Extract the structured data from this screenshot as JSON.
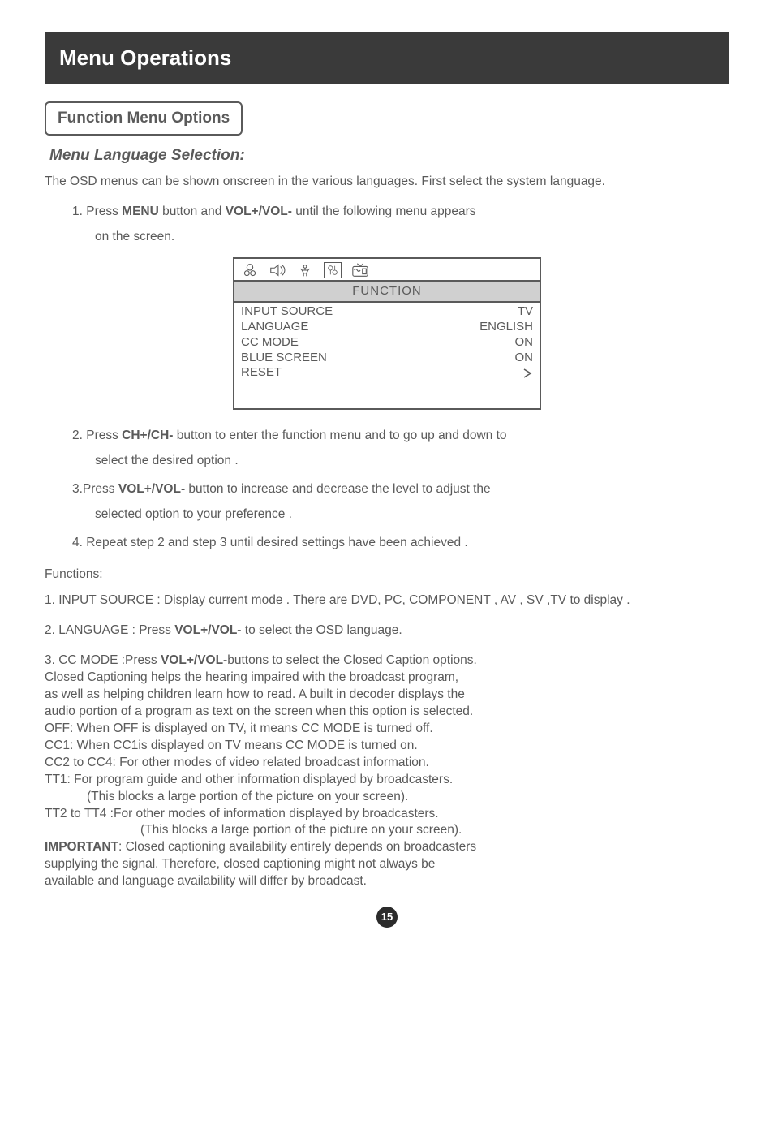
{
  "header": {
    "title": "Menu Operations"
  },
  "section": {
    "title": "Function Menu Options"
  },
  "subsection": {
    "title": "Menu Language Selection:"
  },
  "intro": "The OSD menus can be shown onscreen in the various languages. First select the system language.",
  "step1": {
    "prefix": "1. Press ",
    "kw1": "MENU",
    "mid": " button and ",
    "kw2": "VOL+/VOL-",
    "suffix": " until the following menu appears",
    "cont": "on the screen."
  },
  "osd": {
    "title": "FUNCTION",
    "rows": [
      {
        "label": "INPUT SOURCE",
        "value": "TV"
      },
      {
        "label": "LANGUAGE",
        "value": "ENGLISH"
      },
      {
        "label": "CC MODE",
        "value": "ON"
      },
      {
        "label": "BLUE SCREEN",
        "value": "ON"
      },
      {
        "label": "RESET",
        "value": ""
      }
    ]
  },
  "step2": {
    "prefix": "2. Press ",
    "kw": "CH+/CH-",
    "suffix": " button to enter the function menu and to go up and down to",
    "cont": "select the desired option ."
  },
  "step3": {
    "prefix": "3.Press ",
    "kw": "VOL+/VOL-",
    "suffix": " button to increase and decrease the level to adjust the",
    "cont": "selected option to your preference ."
  },
  "step4": "4. Repeat step 2 and step 3 until desired settings have been achieved .",
  "functionsLabel": "Functions:",
  "f1": "1. INPUT SOURCE : Display current mode . There are DVD, PC, COMPONENT , AV , SV ,TV  to display .",
  "f2": {
    "prefix": "2. LANGUAGE : Press ",
    "kw": "VOL+/VOL-",
    "suffix": " to select the OSD language."
  },
  "f3": {
    "line1a": "3. CC MODE :Press ",
    "kw": "VOL+/VOL-",
    "line1b": "buttons to select the Closed Caption options.",
    "line2": "Closed Captioning helps the hearing impaired with the broadcast program,",
    "line3": "as well as helping children learn how to read.  A built in decoder displays the",
    "line4": "audio portion of a program as text on the screen when this  option is selected.",
    "off": "OFF:  When OFF is displayed on TV, it means CC MODE is turned off.",
    "cc1": "CC1:  When CC1is displayed on TV means CC MODE is turned on.",
    "cc2": "CC2 to CC4:  For other modes of video related broadcast information.",
    "tt1": "TT1: For program guide and other information displayed by broadcasters.",
    "tt1b": "(This blocks a large portion of the picture on your screen).",
    "tt2": "TT2 to TT4 :For other modes of information displayed by broadcasters.",
    "tt2b": "(This blocks a large portion of the picture on your screen).",
    "impKw": "IMPORTANT",
    "imp1": ": Closed captioning availability entirely depends on broadcasters",
    "imp2": "supplying the signal. Therefore, closed captioning might not always be",
    "imp3": "available and language availability will differ by broadcast."
  },
  "pageNumber": "15"
}
